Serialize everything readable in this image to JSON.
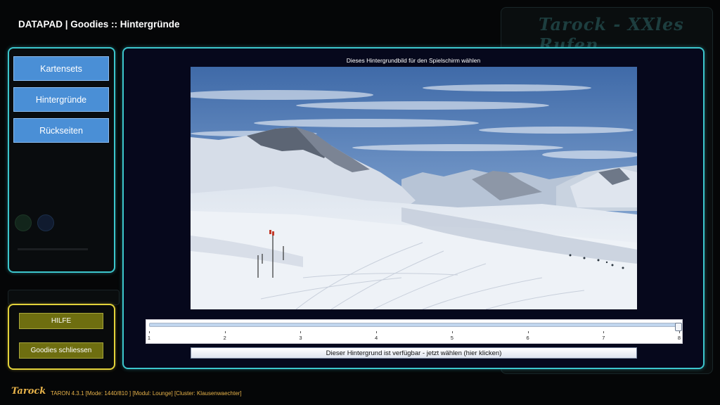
{
  "header": {
    "title": "DATAPAD | Goodies :: Hintergründe"
  },
  "background": {
    "logo_text": "Tarock - XXles Rufen"
  },
  "sidebar": {
    "items": [
      {
        "label": "Kartensets"
      },
      {
        "label": "Hintergründe"
      },
      {
        "label": "Rückseiten"
      }
    ]
  },
  "help_panel": {
    "help_label": "HILFE",
    "close_label": "Goodies schliessen"
  },
  "main": {
    "caption": "Dieses Hintergrundbild für den Spielschirm wählen",
    "slider": {
      "min": 1,
      "max": 8,
      "value": 8,
      "ticks": [
        "1",
        "2",
        "3",
        "4",
        "5",
        "6",
        "7",
        "8"
      ]
    },
    "choose_button": "Dieser Hintergrund ist verfügbar - jetzt wählen (hier klicken)"
  },
  "footer": {
    "logo_text": "Tarock",
    "status_text": "TARON 4.3.1 [Mode: 1440/810 ] [Modul: Lounge] [Cluster: Klausenwaechter]"
  },
  "colors": {
    "accent_cyan": "#3cc6cc",
    "accent_yellow": "#e2d23a",
    "nav_button": "#4a8fd6",
    "olive_button": "#6e6e10",
    "footer_text": "#e8b34a"
  }
}
